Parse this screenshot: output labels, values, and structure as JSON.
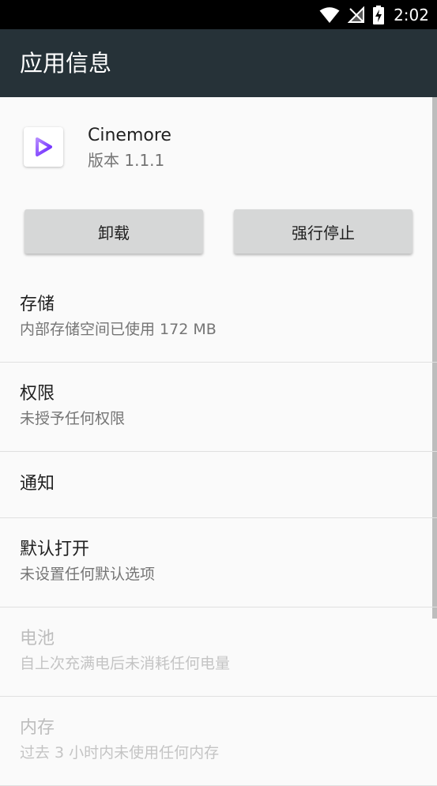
{
  "status_bar": {
    "time": "2:02",
    "icons": [
      "wifi-icon",
      "no-signal-icon",
      "battery-charging-icon"
    ]
  },
  "app_bar": {
    "title": "应用信息"
  },
  "app": {
    "name": "Cinemore",
    "version": "版本 1.1.1",
    "icon": "cinemore-play-icon",
    "icon_color": "#7c4dff"
  },
  "buttons": {
    "uninstall": "卸载",
    "force_stop": "强行停止"
  },
  "items": [
    {
      "title": "存储",
      "subtitle": "内部存储空间已使用 172 MB",
      "enabled": true
    },
    {
      "title": "权限",
      "subtitle": "未授予任何权限",
      "enabled": true
    },
    {
      "title": "通知",
      "subtitle": "",
      "enabled": true
    },
    {
      "title": "默认打开",
      "subtitle": "未设置任何默认选项",
      "enabled": true
    },
    {
      "title": "电池",
      "subtitle": "自上次充满电后未消耗任何电量",
      "enabled": false
    },
    {
      "title": "内存",
      "subtitle": "过去 3 小时内未使用任何内存",
      "enabled": false
    }
  ],
  "colors": {
    "app_bar": "#263238",
    "status_bar": "#000000",
    "background": "#fafafa",
    "button": "#d6d7d7"
  }
}
